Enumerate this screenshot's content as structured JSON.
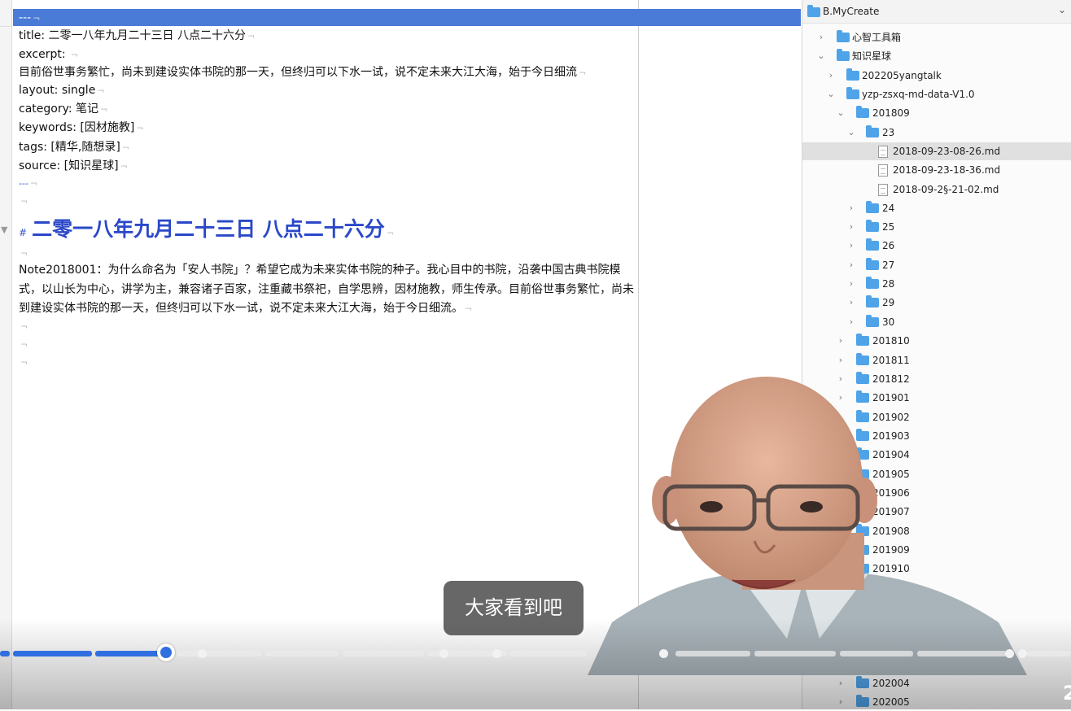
{
  "editor": {
    "frontmatter_delim": "---",
    "lines": [
      {
        "key": "title: ",
        "value": "  二零一八年九月二十三日 八点二十六分"
      },
      {
        "key": "excerpt: ",
        "value": ""
      },
      {
        "key": "",
        "value": "目前俗世事务繁忙，尚未到建设实体书院的那一天，但终归可以下水一试，说不定未来大江大海，始于今日细流"
      },
      {
        "key": "layout: ",
        "value": "single"
      },
      {
        "key": "category: ",
        "value": "笔记"
      },
      {
        "key": "keywords: ",
        "value": "[因材施教]"
      },
      {
        "key": "tags: ",
        "value": "[精华,随想录]"
      },
      {
        "key": "source: ",
        "value": "[知识星球]"
      }
    ],
    "heading_marker": "#",
    "heading": "二零一八年九月二十三日 八点二十六分",
    "body_lines": [
      "Note2018001：为什么命名为「安人书院」？希望它成为未来实体书院的种子。我心目中的书院，沿袭中国古典书院模",
      "式，以山长为中心，讲学为主，兼容诸子百家，注重藏书祭祀，自学思辨，因材施教，师生传承。目前俗世事务繁忙，尚未",
      "到建设实体书院的那一天，但终归可以下水一试，说不定未来大江大海，始于今日细流。"
    ],
    "pilcrow": "¬"
  },
  "tree": {
    "root": "B.MyCreate",
    "items": [
      {
        "label": "心智工具箱",
        "kind": "folder",
        "expanded": false
      },
      {
        "label": "知识星球",
        "kind": "folder",
        "expanded": true
      },
      {
        "label": "202205yangtalk",
        "kind": "folder",
        "expanded": false
      },
      {
        "label": "yzp-zsxq-md-data-V1.0",
        "kind": "folder",
        "expanded": true
      },
      {
        "label": "201809",
        "kind": "folder",
        "expanded": true
      },
      {
        "label": "23",
        "kind": "folder",
        "expanded": true
      },
      {
        "label": "2018-09-23-08-26.md",
        "kind": "file",
        "selected": true
      },
      {
        "label": "2018-09-23-18-36.md",
        "kind": "file"
      },
      {
        "label": "2018-09-2§-21-02.md",
        "kind": "file"
      },
      {
        "label": "24",
        "kind": "folder"
      },
      {
        "label": "25",
        "kind": "folder"
      },
      {
        "label": "26",
        "kind": "folder"
      },
      {
        "label": "27",
        "kind": "folder"
      },
      {
        "label": "28",
        "kind": "folder"
      },
      {
        "label": "29",
        "kind": "folder"
      },
      {
        "label": "30",
        "kind": "folder"
      },
      {
        "label": "201810",
        "kind": "folder"
      },
      {
        "label": "201811",
        "kind": "folder"
      },
      {
        "label": "201812",
        "kind": "folder"
      },
      {
        "label": "201901",
        "kind": "folder"
      },
      {
        "label": "201902",
        "kind": "folder"
      },
      {
        "label": "201903",
        "kind": "folder"
      },
      {
        "label": "201904",
        "kind": "folder"
      },
      {
        "label": "201905",
        "kind": "folder"
      },
      {
        "label": "201906",
        "kind": "folder"
      },
      {
        "label": "201907",
        "kind": "folder"
      },
      {
        "label": "201908",
        "kind": "folder"
      },
      {
        "label": "201909",
        "kind": "folder"
      },
      {
        "label": "201910",
        "kind": "folder"
      },
      {
        "label": "202004",
        "kind": "folder"
      },
      {
        "label": "202005",
        "kind": "folder"
      }
    ]
  },
  "player": {
    "subtitle": "大家看到吧",
    "progress_played_fraction": 0.157,
    "time_fragment": "2"
  },
  "colors": {
    "accent": "#2f6fe0",
    "heading": "#2a48c8",
    "folder": "#4fa3e8"
  }
}
